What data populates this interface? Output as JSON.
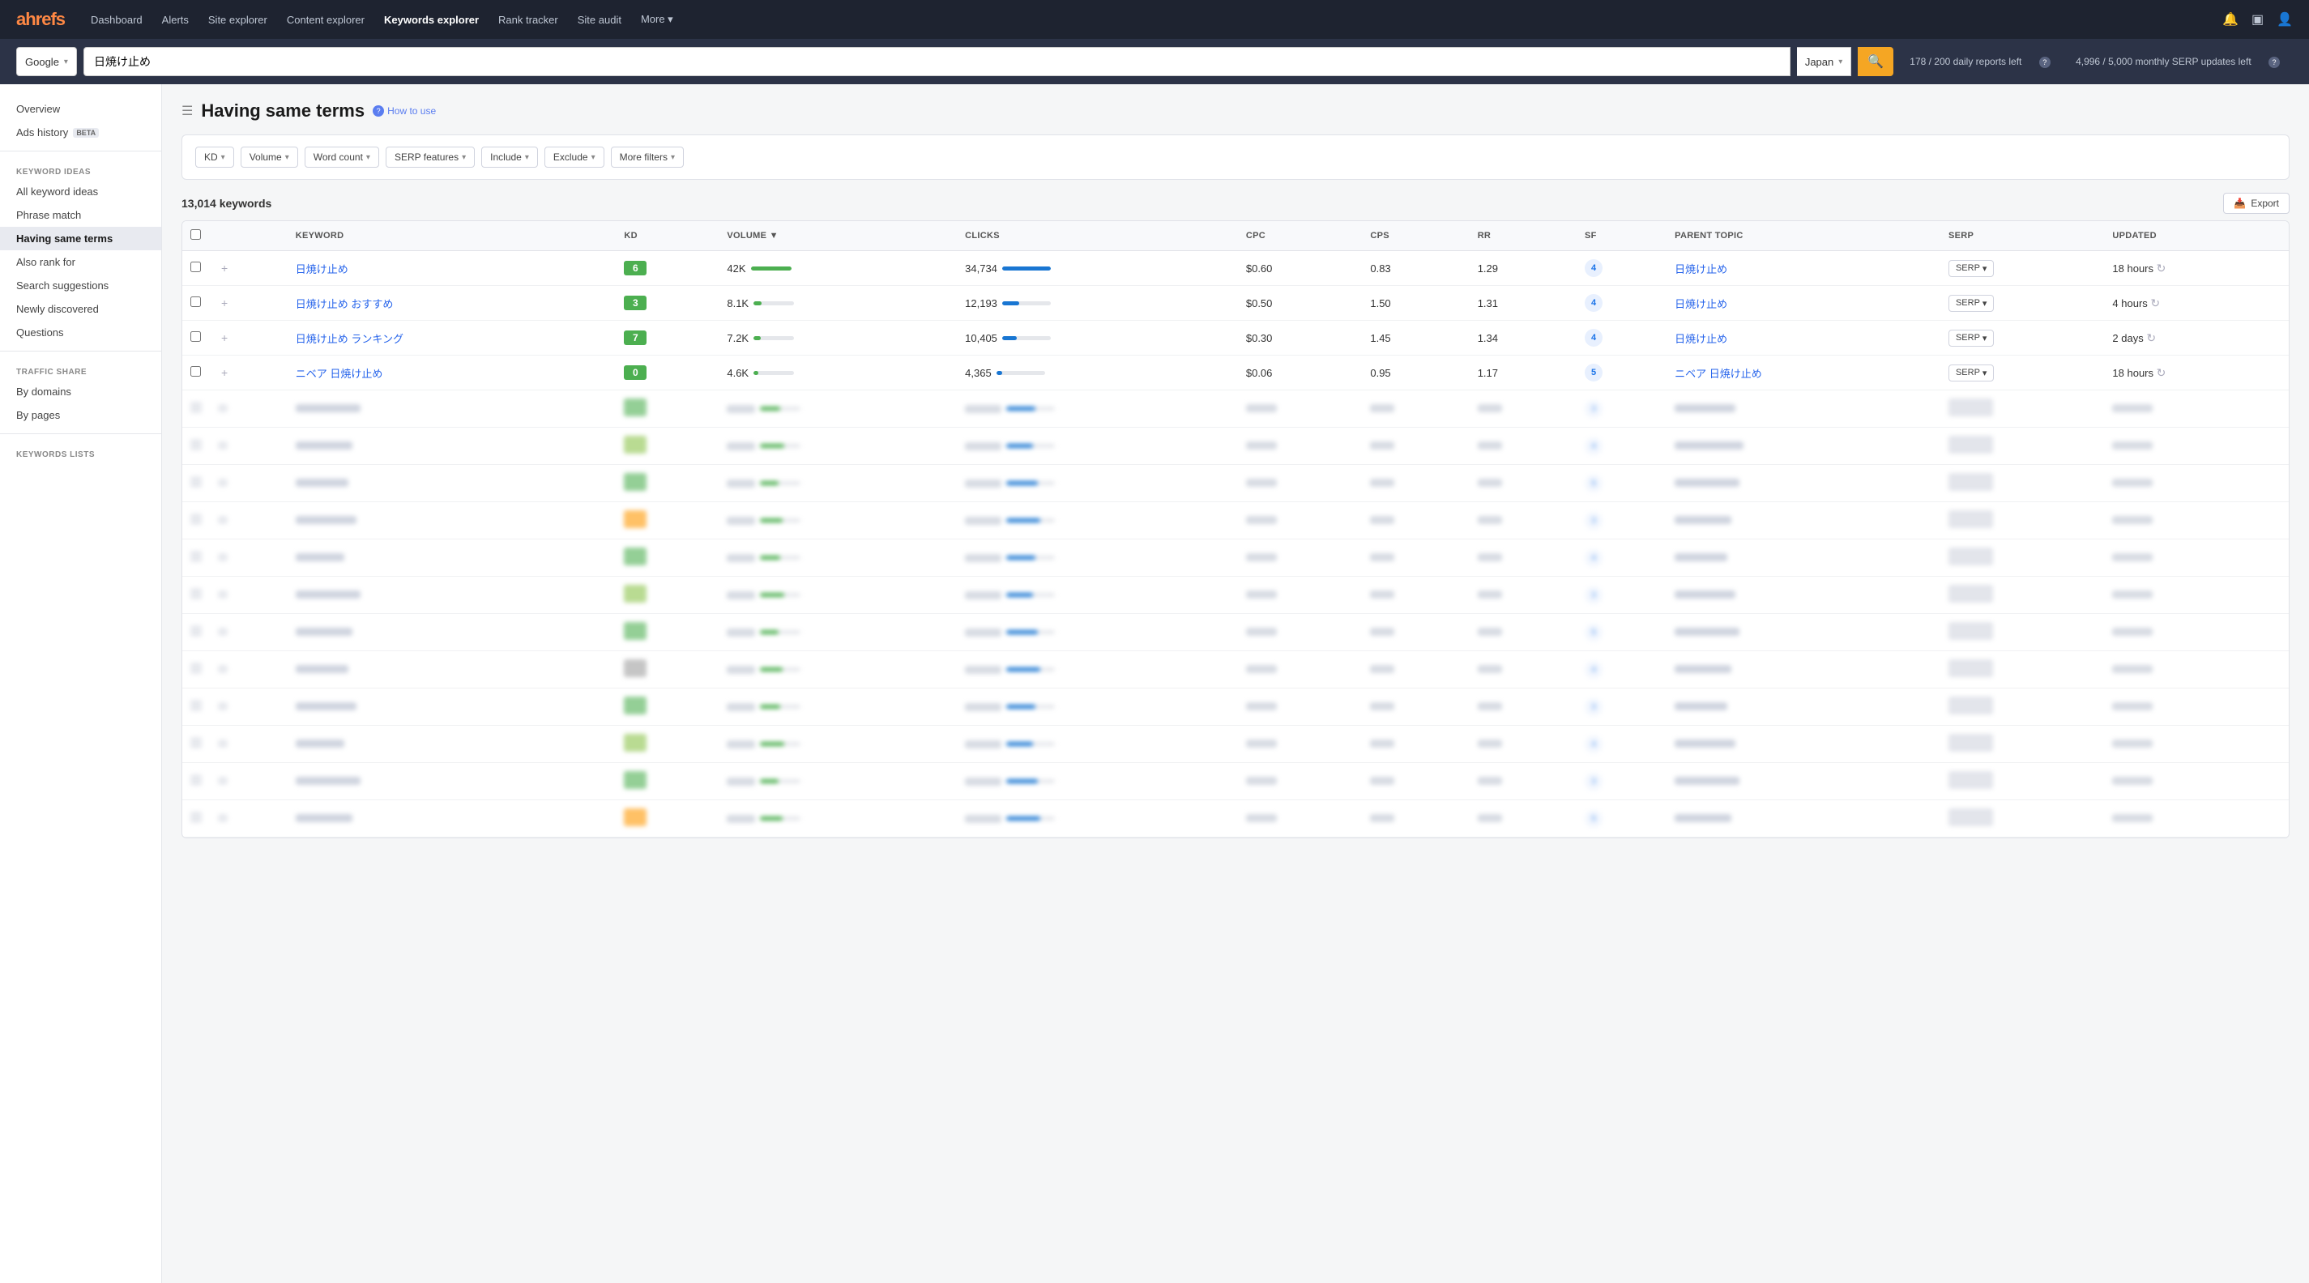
{
  "nav": {
    "logo": "ahrefs",
    "links": [
      {
        "label": "Dashboard",
        "active": false
      },
      {
        "label": "Alerts",
        "active": false
      },
      {
        "label": "Site explorer",
        "active": false
      },
      {
        "label": "Content explorer",
        "active": false
      },
      {
        "label": "Keywords explorer",
        "active": true
      },
      {
        "label": "Rank tracker",
        "active": false
      },
      {
        "label": "Site audit",
        "active": false
      },
      {
        "label": "More",
        "active": false,
        "dropdown": true
      }
    ]
  },
  "search": {
    "engine": "Google",
    "query": "日焼け止め",
    "country": "Japan",
    "search_icon": "🔍",
    "stats": {
      "daily": "178 / 200 daily reports left",
      "monthly": "4,996 / 5,000 monthly SERP updates left"
    }
  },
  "sidebar": {
    "top_items": [
      {
        "label": "Overview",
        "active": false
      },
      {
        "label": "Ads history",
        "active": false,
        "beta": true
      }
    ],
    "keyword_ideas_section": "KEYWORD IDEAS",
    "keyword_ideas": [
      {
        "label": "All keyword ideas",
        "active": false
      },
      {
        "label": "Phrase match",
        "active": false
      },
      {
        "label": "Having same terms",
        "active": true
      },
      {
        "label": "Also rank for",
        "active": false
      },
      {
        "label": "Search suggestions",
        "active": false
      },
      {
        "label": "Newly discovered",
        "active": false
      },
      {
        "label": "Questions",
        "active": false
      }
    ],
    "traffic_share_section": "TRAFFIC SHARE",
    "traffic_share": [
      {
        "label": "By domains",
        "active": false
      },
      {
        "label": "By pages",
        "active": false
      }
    ],
    "keywords_lists_section": "KEYWORDS LISTS"
  },
  "page": {
    "title": "Having same terms",
    "how_to_use": "How to use"
  },
  "filters": [
    {
      "label": "KD",
      "dropdown": true
    },
    {
      "label": "Volume",
      "dropdown": true
    },
    {
      "label": "Word count",
      "dropdown": true
    },
    {
      "label": "SERP features",
      "dropdown": true
    },
    {
      "label": "Include",
      "dropdown": true
    },
    {
      "label": "Exclude",
      "dropdown": true
    },
    {
      "label": "More filters",
      "dropdown": true
    }
  ],
  "results": {
    "count": "13,014 keywords",
    "export_label": "Export"
  },
  "table": {
    "columns": [
      "",
      "",
      "Keyword",
      "KD",
      "Volume",
      "Clicks",
      "CPC",
      "CPS",
      "RR",
      "SF",
      "Parent topic",
      "SERP",
      "Updated"
    ],
    "rows": [
      {
        "keyword": "日焼け止め",
        "kd": "6",
        "kd_color": "green",
        "volume": "42K",
        "vol_pct": 100,
        "clicks": "34,734",
        "clicks_pct": 100,
        "cpc": "$0.60",
        "cps": "0.83",
        "rr": "1.29",
        "sf": "4",
        "parent_topic": "日焼け止め",
        "updated": "18 hours",
        "blurred": false
      },
      {
        "keyword": "日焼け止め おすすめ",
        "kd": "3",
        "kd_color": "green",
        "volume": "8.1K",
        "vol_pct": 19,
        "clicks": "12,193",
        "clicks_pct": 35,
        "cpc": "$0.50",
        "cps": "1.50",
        "rr": "1.31",
        "sf": "4",
        "parent_topic": "日焼け止め",
        "updated": "4 hours",
        "blurred": false
      },
      {
        "keyword": "日焼け止め ランキング",
        "kd": "7",
        "kd_color": "green",
        "volume": "7.2K",
        "vol_pct": 17,
        "clicks": "10,405",
        "clicks_pct": 30,
        "cpc": "$0.30",
        "cps": "1.45",
        "rr": "1.34",
        "sf": "4",
        "parent_topic": "日焼け止め",
        "updated": "2 days",
        "blurred": false
      },
      {
        "keyword": "ニベア 日焼け止め",
        "kd": "0",
        "kd_color": "green",
        "volume": "4.6K",
        "vol_pct": 11,
        "clicks": "4,365",
        "clicks_pct": 13,
        "cpc": "$0.06",
        "cps": "0.95",
        "rr": "1.17",
        "sf": "5",
        "parent_topic": "ニベア 日焼け止め",
        "updated": "18 hours",
        "blurred": false
      }
    ],
    "blurred_rows": 12
  }
}
